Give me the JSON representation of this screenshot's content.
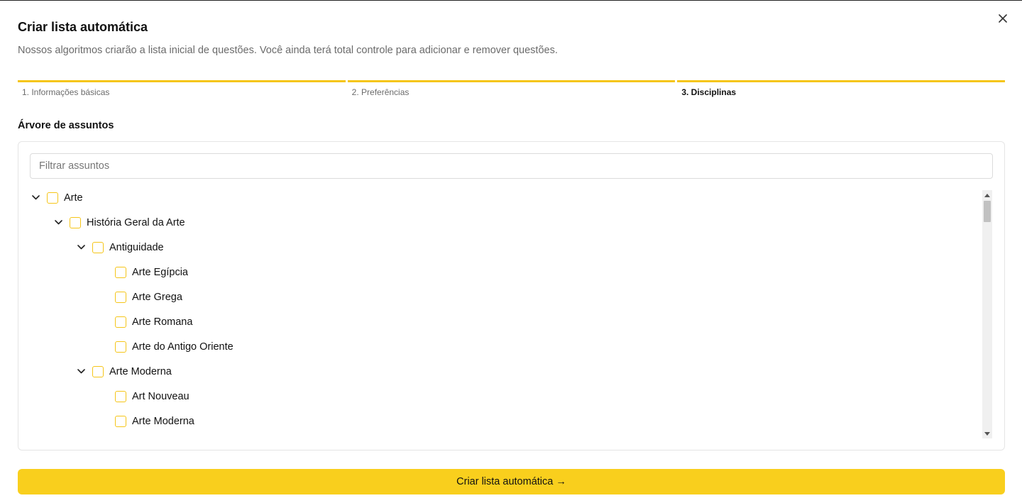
{
  "modal": {
    "title": "Criar lista automática",
    "subtitle": "Nossos algoritmos criarão a lista inicial de questões. Você ainda terá total controle para adicionar e remover questões.",
    "close_icon": "close-icon"
  },
  "steps": [
    {
      "label": "1. Informações básicas",
      "active": false
    },
    {
      "label": "2. Preferências",
      "active": false
    },
    {
      "label": "3. Disciplinas",
      "active": true
    }
  ],
  "tree_section": {
    "label": "Árvore de assuntos",
    "filter_placeholder": "Filtrar assuntos",
    "nodes": [
      {
        "label": "Arte",
        "level": 0,
        "expandable": true,
        "expanded": true,
        "checked": false
      },
      {
        "label": "História Geral da Arte",
        "level": 1,
        "expandable": true,
        "expanded": true,
        "checked": false
      },
      {
        "label": "Antiguidade",
        "level": 2,
        "expandable": true,
        "expanded": true,
        "checked": false
      },
      {
        "label": "Arte Egípcia",
        "level": 3,
        "expandable": false,
        "checked": false
      },
      {
        "label": "Arte Grega",
        "level": 3,
        "expandable": false,
        "checked": false
      },
      {
        "label": "Arte Romana",
        "level": 3,
        "expandable": false,
        "checked": false
      },
      {
        "label": "Arte do Antigo Oriente",
        "level": 3,
        "expandable": false,
        "checked": false
      },
      {
        "label": "Arte Moderna",
        "level": 2,
        "expandable": true,
        "expanded": true,
        "checked": false
      },
      {
        "label": "Art Nouveau",
        "level": 3,
        "expandable": false,
        "checked": false
      },
      {
        "label": "Arte Moderna",
        "level": 3,
        "expandable": false,
        "checked": false
      }
    ]
  },
  "cta": {
    "label": "Criar lista automática →"
  },
  "colors": {
    "accent": "#f9cf1d",
    "checkbox_border": "#f5c518",
    "progress": "#f5c518"
  }
}
